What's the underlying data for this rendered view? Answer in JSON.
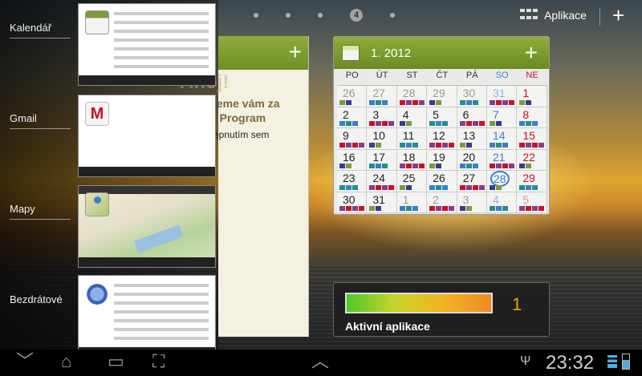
{
  "home": {
    "page_indicator": "4",
    "apps_label": "Aplikace",
    "add_symbol": "+"
  },
  "recents": [
    {
      "label": "Kalendář",
      "icon": "calendar-icon"
    },
    {
      "label": "Gmail",
      "icon": "gmail-icon"
    },
    {
      "label": "Mapy",
      "icon": "maps-icon"
    },
    {
      "label": "Bezdrátové",
      "icon": "wireless-settings-icon"
    }
  ],
  "note_widget": {
    "title": "Ahoj!",
    "line1": "jeme vám za",
    "line2": "e Program",
    "line3": "epnutím sem",
    "add_symbol": "+"
  },
  "calendar": {
    "month": "1. 2012",
    "add_symbol": "+",
    "weekdays": [
      "PO",
      "ÚT",
      "ST",
      "ČT",
      "PÁ",
      "SO",
      "NE"
    ],
    "days": [
      "26",
      "27",
      "28",
      "29",
      "30",
      "31",
      "1",
      "2",
      "3",
      "4",
      "5",
      "6",
      "7",
      "8",
      "9",
      "10",
      "11",
      "12",
      "13",
      "14",
      "15",
      "16",
      "17",
      "18",
      "19",
      "20",
      "21",
      "22",
      "23",
      "24",
      "25",
      "26",
      "27",
      "28",
      "29",
      "30",
      "31",
      "1",
      "2",
      "3",
      "4",
      "5"
    ],
    "today": "28",
    "colors": {
      "green": "#7a9a3c",
      "blue": "#3a7ed0",
      "red": "#c8102e"
    }
  },
  "activity": {
    "count": "1",
    "label": "Aktivní aplikace",
    "level": 1.0
  },
  "statusbar": {
    "time": "23:32"
  }
}
